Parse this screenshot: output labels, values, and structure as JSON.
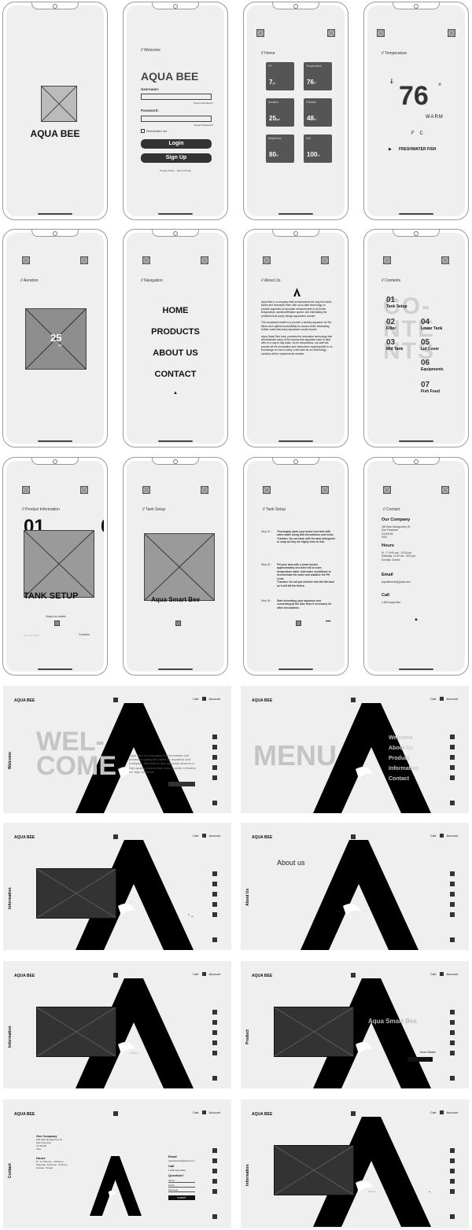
{
  "mobile": {
    "splash": {
      "brand": "AQUA BEE"
    },
    "login": {
      "section": "// Welcome",
      "title": "AQUA BEE",
      "username_label": "Username:",
      "forgot_username": "Forgot Username?",
      "password_label": "Password:",
      "forgot_password": "Forgot Password?",
      "remember": "Remember me",
      "login_btn": "Login",
      "signup_btn": "Sign Up",
      "footer": "Privacy Policy · Terms Of Use"
    },
    "home": {
      "section": "// Home",
      "tiles": [
        {
          "label": "PH",
          "value": "7",
          "unit": "ph"
        },
        {
          "label": "Temperature",
          "value": "76",
          "unit": "°F"
        },
        {
          "label": "Aeration",
          "value": "25",
          "unit": "gal"
        },
        {
          "label": "Filtration",
          "value": "48",
          "unit": "hr"
        },
        {
          "label": "Brightness",
          "value": "80",
          "unit": "%"
        },
        {
          "label": "N/A",
          "value": "100",
          "unit": "%"
        }
      ]
    },
    "temperature": {
      "section": "// Temperature",
      "value": "76",
      "degree": "°",
      "state": "WARM",
      "units": "F    C",
      "fish": "FRESHWATER FISH"
    },
    "aeration": {
      "section": "// Aeration",
      "value": "25",
      "unit": "gal"
    },
    "navigation": {
      "section": "// Navigation",
      "items": [
        "HOME",
        "PRODUCTS",
        "ABOUT US",
        "CONTACT"
      ]
    },
    "about": {
      "section": "// About Us",
      "paragraphs": [
        "Aqua Bee is a company that revolutionizes the way fish tanks works and increases them with up-to-date technology to provide aquarists an accurate measurement of ph levels, temperature, aeration/filtration speed, and eliminating the problems that poorly design aquariums consist.",
        "The companies belief is to provide a healthy aquarium for the fishes and optimal accessibility for owners while eliminating further costs that many aquariums would require.",
        "Aqua Smart Bee tank, provides the innovative technology that will eliminate many of the worries that aquarists have to deal with on a day to day basis. As for decorations, our staff will provide all the necessities and instructions requiring little to no knowledge on how to setup a fish tank as our technology contains all the requirements needed."
      ]
    },
    "contents": {
      "section": "// Contents",
      "bg_text": "CO-\nNTE\nNTS",
      "items": [
        {
          "num": "01",
          "label": "Tank Setup"
        },
        {
          "num": "02",
          "label": "Filter"
        },
        {
          "num": "03",
          "label": "Mid Tank"
        },
        {
          "num": "04",
          "label": "Lower Tank"
        },
        {
          "num": "05",
          "label": "Lid Cover"
        },
        {
          "num": "06",
          "label": "Equipments"
        },
        {
          "num": "07",
          "label": "Fish Food"
        }
      ]
    },
    "product_info": {
      "section": "// Product Information",
      "num": "01",
      "title": "TANK SETUP",
      "swipe": "Swipe for details",
      "contents_link": "Contents"
    },
    "tank_setup_a": {
      "section": "// Tank Setup",
      "title": "Aqua Smart Bee"
    },
    "tank_setup_b": {
      "section": "// Tank Setup",
      "steps": [
        {
          "label": "Step 01 :",
          "text": "Thoroughly wash your brand new tank with warm water along with decorations and rocks.\n*Caution: Do not wash with the tank detergents or soap as they are highly toxic to fish."
        },
        {
          "label": "Step 02 :",
          "text": "Fill your tank with a clean bucket approximately one-third full of room temperature water. Add water conditioner to dechlorinate the water and stabilize the PH Level.\n*Caution: Do not put chlorine into the fish tank as it will kill the fishes."
        },
        {
          "label": "Step 03 :",
          "text": "Start decorating your aquarium and connecting all the tube lines if necessary for other decorations."
        }
      ]
    },
    "contact": {
      "section": "// Contact",
      "company_title": "Our Company",
      "company": "180 New Montgomery St\nSan Francisco\nCA 94105\nUSA",
      "hours_title": "Hours",
      "hours": "M - F: 8:00 am - 10:00 pm\nSaturday: 11:00 am - 8:00 pm\nSunday: Closed",
      "email_title": "Email",
      "email": "Aquabeeinfo@gmail.com",
      "call_title": "Call",
      "call": "1-800-Aqua-Bee"
    }
  },
  "desktop": {
    "brand": "AQUA BEE",
    "cart": "Cart",
    "account": "Account",
    "welcome": {
      "side": "Welcome",
      "big": "WEL-\nCOME",
      "text": "Aqua Bee is a company that increases and produces quality fish tanks for aquarists and hobbyists. We believe that aquarists deserve a high quality product that helps provide a healthy life style for fishes."
    },
    "menu": {
      "big": "MENU",
      "items": [
        "Welcome",
        "About Us",
        "Product",
        "Information",
        "Contact"
      ]
    },
    "info1": {
      "side": "Information"
    },
    "about": {
      "side": "About Us",
      "title": "About us"
    },
    "info2": {
      "side": "Information"
    },
    "product": {
      "side": "Product",
      "title": "Aqua Smart Bee",
      "link": "More Details"
    },
    "contact": {
      "side": "Contact",
      "company_title": "Our Company",
      "company": "180 New Montgomery St\nSan Francisco\nCA 94105\nUSA",
      "hours_title": "Hours",
      "hours": "M - F: 8:00 am - 10:00 pm\nSaturday: 11:00 am - 8:00 pm\nSunday: Closed",
      "email_title": "Email",
      "email": "Aquabeeinfo@gmail.com",
      "call_title": "Call",
      "call": "1-800-Aqua-Bee",
      "question_title": "Question?",
      "name_ph": "Name",
      "email_ph": "Email",
      "message_ph": "Message",
      "submit": "SUBMIT"
    },
    "info3": {
      "side": "Information"
    }
  }
}
